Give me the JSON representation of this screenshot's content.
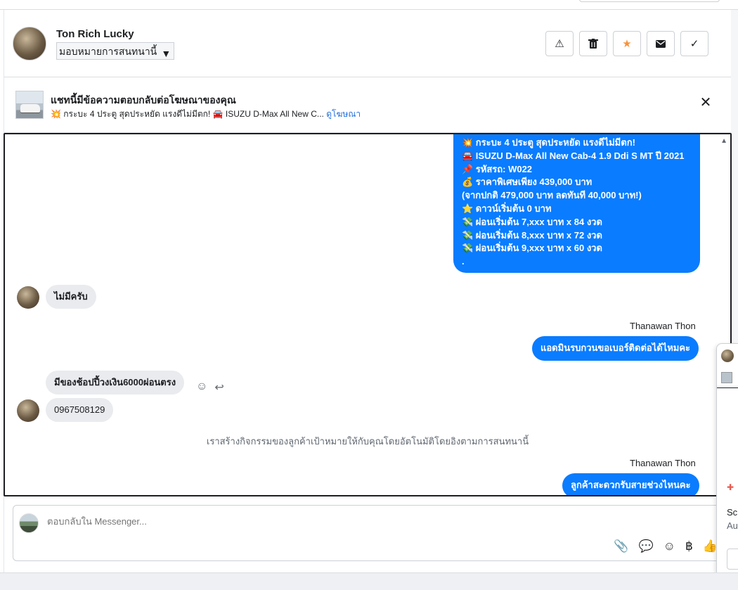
{
  "header": {
    "contact_name": "Ton Rich Lucky",
    "assign_label": "มอบหมายการสนทนานี้",
    "actions": [
      "spam-icon",
      "trash-icon",
      "star-icon",
      "mail-icon",
      "check-icon"
    ]
  },
  "ad_banner": {
    "title": "แชทนี้มีข้อความตอบกลับต่อโฆษณาของคุณ",
    "subtitle": "💥 กระบะ 4 ประตู สุดประหยัด แรงดีไม่มีตก! 🚘 ISUZU D-Max All New C...",
    "link": "ดูโฆษณา"
  },
  "thread": {
    "ad_message_lines": [
      "💥 กระบะ 4 ประตู สุดประหยัด แรงดีไม่มีตก!",
      "🚘 ISUZU D-Max All New Cab-4 1.9 Ddi S MT ปี 2021",
      "📌 รหัสรถ: W022",
      "💰 ราคาพิเศษเพียง 439,000 บาท",
      "(จากปกติ 479,000 บาท ลดทันที 40,000 บาท!)",
      "⭐ ดาวน์เริ่มต้น 0 บาท",
      "💸 ผ่อนเริ่มต้น 7,xxx บาท x 84 งวด",
      "💸 ผ่อนเริ่มต้น 8,xxx บาท x 72 งวด",
      "💸 ผ่อนเริ่มต้น 9,xxx บาท x 60 งวด",
      "."
    ],
    "reply_1": "ไม่มีครับ",
    "sender_1": "Thanawan Thon",
    "outgoing_1": "แอดมินรบกวนขอเบอร์ติดต่อได้ไหมคะ",
    "reply_2": "มีของช้อปปี้วงเงิน6000ผ่อนตรง",
    "reply_3": "0967508129",
    "notice": "เราสร้างกิจกรรมของลูกค้าเป้าหมายให้กับคุณโดยอัตโนมัติโดยอิงตามการสนทนานี้",
    "sender_2": "Thanawan Thon",
    "outgoing_2": "ลูกค้าสะดวกรับสายช่วงไหนคะ"
  },
  "composer": {
    "placeholder": "ตอบกลับใน Messenger..."
  },
  "overlay": {
    "line_1": "Sc",
    "line_2": "Au"
  }
}
